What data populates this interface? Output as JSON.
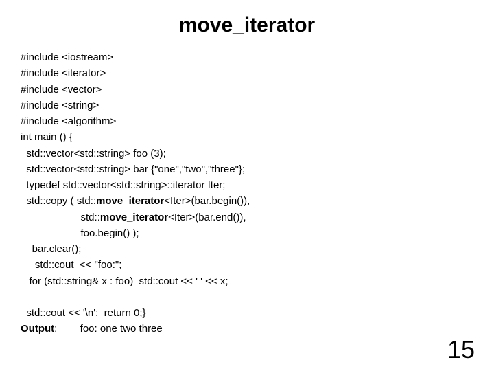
{
  "title": "move_iterator",
  "code": {
    "l1": "#include <iostream>",
    "l2": "#include <iterator>",
    "l3": "#include <vector>",
    "l4": "#include <string>",
    "l5": "#include <algorithm>",
    "l6": "int main () {",
    "l7": "  std::vector<std::string> foo (3);",
    "l8": "  std::vector<std::string> bar {\"one\",\"two\",\"three\"};",
    "l9": "  typedef std::vector<std::string>::iterator Iter;",
    "l10a": "  std::copy ( std::",
    "l10b": "move_iterator",
    "l10c": "<Iter>(bar.begin()),",
    "l11a": "                     std::",
    "l11b": "move_iterator",
    "l11c": "<Iter>(bar.end()),",
    "l12": "                     foo.begin() );",
    "l13": "    bar.clear();",
    "l14": "     std::cout  << \"foo:\";",
    "l15": "   for (std::string& x : foo)  std::cout << ' ' << x;",
    "l16": "",
    "l17": "  std::cout << '\\n';  return 0;}",
    "outLabel": "Output",
    "outText": ":        foo: one two three"
  },
  "pageNumber": "15"
}
